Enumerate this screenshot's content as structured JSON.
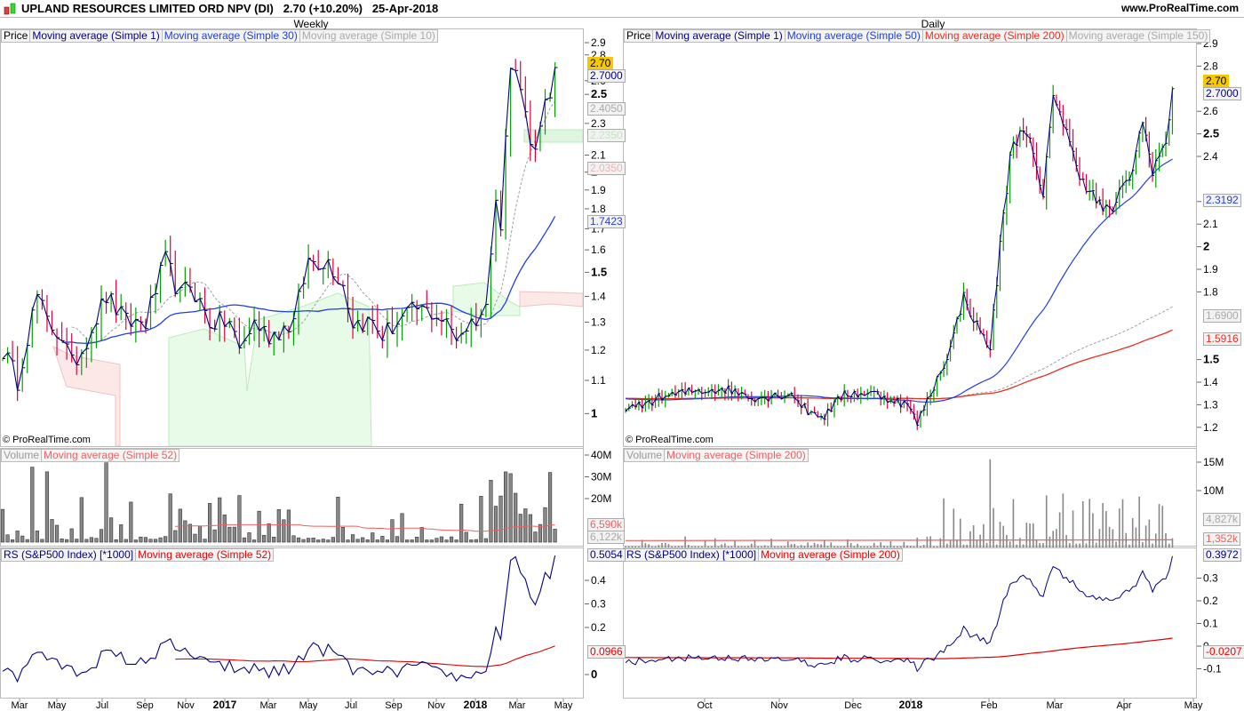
{
  "header": {
    "title": "UPLAND RESOURCES LIMITED ORD NPV (DI)",
    "price": "2.70",
    "change": "(+10.20%)",
    "date": "25-Apr-2018",
    "site": "www.ProRealTime.com"
  },
  "colors": {
    "up": "#00a000",
    "down": "#e0003c",
    "ma1": "#000080",
    "ma_blue": "#2040e0",
    "ma_red": "#e83020",
    "ma_gray": "#a0a0a0",
    "highlight": "#f5c800"
  },
  "weekly": {
    "title": "Weekly",
    "price_legend": [
      "Price",
      "Moving average (Simple 1)",
      "Moving average (Simple 30)",
      "Moving average (Simple 10)"
    ],
    "volume_legend": [
      "Volume",
      "Moving average (Simple 52)"
    ],
    "rs_legend": [
      "RS (S&P500 Index) [*1000]",
      "Moving average (Simple 52)"
    ],
    "copyright": "© ProRealTime.com",
    "labels": {
      "last": "2.70",
      "ma1": "2.7000",
      "ma10": "2.4050",
      "cloud_a": "2.2350",
      "cloud_b": "2.0350",
      "ma30": "1.7423",
      "vol_ma": "6,590k",
      "vol": "6,122k",
      "rs": "0.5054",
      "rs_ma": "0.0966"
    }
  },
  "daily": {
    "title": "Daily",
    "price_legend": [
      "Price",
      "Moving average (Simple 1)",
      "Moving average (Simple 50)",
      "Moving average (Simple 200)",
      "Moving average (Simple 150)"
    ],
    "volume_legend": [
      "Volume",
      "Moving average (Simple 200)"
    ],
    "rs_legend": [
      "RS (S&P500 Index) [*1000]",
      "Moving average (Simple 200)"
    ],
    "copyright": "© ProRealTime.com",
    "labels": {
      "last": "2.70",
      "ma1": "2.7000",
      "ma50": "2.3192",
      "ma150": "1.6900",
      "ma200": "1.5916",
      "vol": "4,827k",
      "vol_ma": "1,352k",
      "rs": "0.3972",
      "rs_ma": "-0.0207"
    }
  },
  "chart_data": [
    {
      "type": "line",
      "name": "weekly",
      "title": "Weekly",
      "scale": "log",
      "ylim": [
        0.95,
        2.95
      ],
      "yticks": [
        2.9,
        2.8,
        2.6,
        2.5,
        2.3,
        2.1,
        2,
        1.9,
        1.8,
        1.7,
        1.6,
        1.5,
        1.4,
        1.3,
        1.2,
        1.1,
        1
      ],
      "bold_ticks": [
        2.5,
        2,
        1.5,
        1
      ],
      "xticks": [
        [
          "Mar",
          false
        ],
        [
          "May",
          false
        ],
        [
          "Jul",
          false
        ],
        [
          "Sep",
          false
        ],
        [
          "Nov",
          false
        ],
        [
          "2017",
          true
        ],
        [
          "Mar",
          false
        ],
        [
          "May",
          false
        ],
        [
          "Jul",
          false
        ],
        [
          "Sep",
          false
        ],
        [
          "Nov",
          false
        ],
        [
          "2018",
          true
        ],
        [
          "Mar",
          false
        ],
        [
          "May",
          false
        ]
      ],
      "weeks": 113,
      "close_keypoints": [
        [
          0,
          1.2
        ],
        [
          3,
          1.1
        ],
        [
          7,
          1.4
        ],
        [
          9,
          1.3
        ],
        [
          12,
          1.25
        ],
        [
          14,
          1.15
        ],
        [
          16,
          1.2
        ],
        [
          21,
          1.4
        ],
        [
          25,
          1.3
        ],
        [
          29,
          1.3
        ],
        [
          33,
          1.55
        ],
        [
          36,
          1.4
        ],
        [
          38,
          1.45
        ],
        [
          42,
          1.3
        ],
        [
          46,
          1.3
        ],
        [
          48,
          1.2
        ],
        [
          51,
          1.3
        ],
        [
          54,
          1.25
        ],
        [
          59,
          1.3
        ],
        [
          62,
          1.55
        ],
        [
          66,
          1.55
        ],
        [
          69,
          1.45
        ],
        [
          71,
          1.3
        ],
        [
          75,
          1.3
        ],
        [
          77,
          1.25
        ],
        [
          80,
          1.3
        ],
        [
          84,
          1.35
        ],
        [
          88,
          1.33
        ],
        [
          92,
          1.25
        ],
        [
          95,
          1.3
        ],
        [
          98,
          1.35
        ],
        [
          100,
          1.9
        ],
        [
          101,
          1.7
        ],
        [
          103,
          2.7
        ],
        [
          105,
          2.6
        ],
        [
          106,
          2.35
        ],
        [
          108,
          2.1
        ],
        [
          110,
          2.4
        ],
        [
          111,
          2.45
        ],
        [
          112,
          2.7
        ]
      ],
      "volume_yticks": [
        "40M",
        "30M",
        "20M"
      ],
      "volume_max_m": 40,
      "rs_yticks": [
        0.4,
        0.3,
        0.2,
        0
      ],
      "rs_ylim": [
        -0.05,
        0.5
      ]
    },
    {
      "type": "line",
      "name": "daily",
      "title": "Daily",
      "scale": "linear",
      "ylim": [
        1.15,
        2.95
      ],
      "yticks": [
        2.9,
        2.8,
        2.6,
        2.5,
        2.4,
        2.2,
        2.1,
        2,
        1.9,
        1.8,
        1.5,
        1.4,
        1.3,
        1.2
      ],
      "bold_ticks": [
        2.5,
        2,
        1.5
      ],
      "xticks": [
        [
          "Oct",
          false
        ],
        [
          "Nov",
          false
        ],
        [
          "Dec",
          false
        ],
        [
          "2018",
          true
        ],
        [
          "Feb",
          false
        ],
        [
          "Mar",
          false
        ],
        [
          "Apr",
          false
        ],
        [
          "May",
          false
        ]
      ],
      "bars": 166,
      "close_keypoints": [
        [
          0,
          1.27
        ],
        [
          10,
          1.33
        ],
        [
          20,
          1.36
        ],
        [
          30,
          1.37
        ],
        [
          40,
          1.33
        ],
        [
          50,
          1.35
        ],
        [
          55,
          1.27
        ],
        [
          60,
          1.25
        ],
        [
          66,
          1.35
        ],
        [
          75,
          1.35
        ],
        [
          85,
          1.3
        ],
        [
          88,
          1.22
        ],
        [
          93,
          1.38
        ],
        [
          98,
          1.55
        ],
        [
          102,
          1.78
        ],
        [
          106,
          1.65
        ],
        [
          110,
          1.55
        ],
        [
          113,
          2.0
        ],
        [
          116,
          2.4
        ],
        [
          120,
          2.55
        ],
        [
          123,
          2.4
        ],
        [
          126,
          2.2
        ],
        [
          129,
          2.7
        ],
        [
          132,
          2.55
        ],
        [
          135,
          2.4
        ],
        [
          138,
          2.3
        ],
        [
          142,
          2.2
        ],
        [
          146,
          2.15
        ],
        [
          150,
          2.25
        ],
        [
          153,
          2.35
        ],
        [
          156,
          2.55
        ],
        [
          159,
          2.35
        ],
        [
          161,
          2.4
        ],
        [
          163,
          2.45
        ],
        [
          165,
          2.7
        ]
      ],
      "volume_yticks": [
        "15M",
        "10M"
      ],
      "rs_yticks": [
        0.3,
        0.2,
        0.1,
        0,
        -0.1
      ],
      "rs_ylim": [
        -0.15,
        0.42
      ]
    }
  ]
}
